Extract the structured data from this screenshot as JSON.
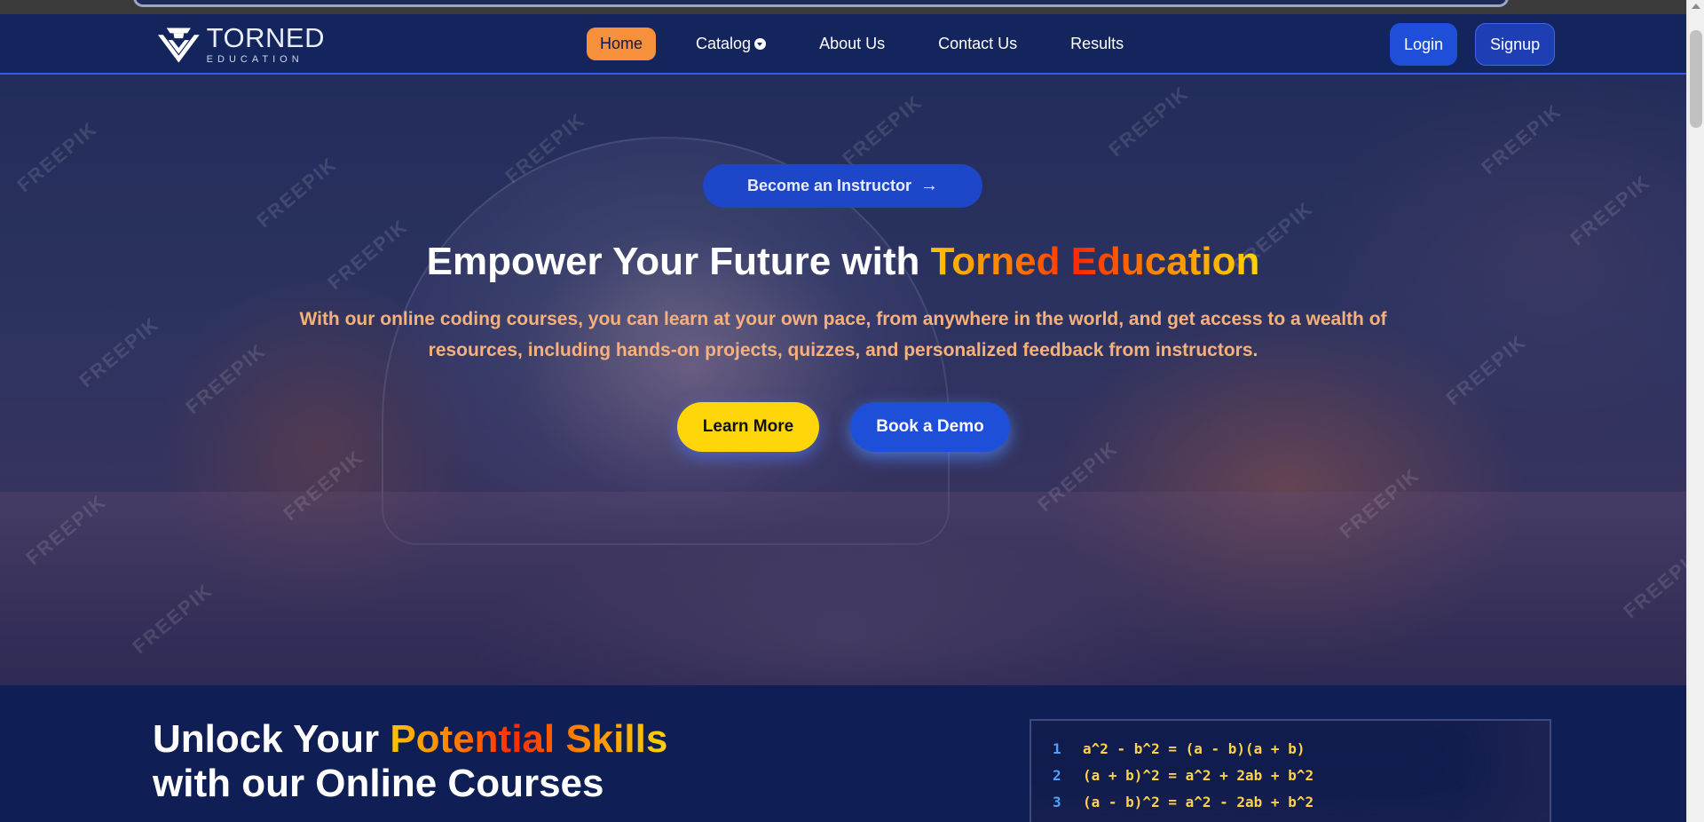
{
  "brand": {
    "name": "TORNED",
    "sub": "EDUCATION"
  },
  "nav": {
    "links": [
      {
        "label": "Home",
        "active": true
      },
      {
        "label": "Catalog",
        "has_dropdown": true
      },
      {
        "label": "About Us"
      },
      {
        "label": "Contact Us"
      },
      {
        "label": "Results"
      }
    ],
    "login": "Login",
    "signup": "Signup"
  },
  "hero": {
    "instructor_btn": "Become an Instructor",
    "title_plain": "Empower Your Future with ",
    "title_highlight": "Torned Education",
    "subtitle": "With our online coding courses, you can learn at your own pace, from anywhere in the world, and get access to a wealth of resources, including hands-on projects, quizzes, and personalized feedback from instructors.",
    "learn_more": "Learn More",
    "book_demo": "Book a Demo",
    "watermark": "FREEPIK"
  },
  "lower": {
    "title_line1_plain": "Unlock Your ",
    "title_line1_highlight": "Potential Skills",
    "title_line2": "with our Online Courses",
    "code_lines": [
      {
        "num": "1",
        "code": "a^2 - b^2 = (a - b)(a + b)"
      },
      {
        "num": "2",
        "code": "(a + b)^2 = a^2 + 2ab + b^2"
      },
      {
        "num": "3",
        "code": "(a - b)^2 = a^2 - 2ab + b^2"
      }
    ]
  },
  "colors": {
    "nav_bg": "#14255e",
    "accent_orange": "#f6903a",
    "primary_blue": "#1f4fd8",
    "cta_yellow": "#ffd60a",
    "subtitle_orange": "#f8b07a"
  }
}
